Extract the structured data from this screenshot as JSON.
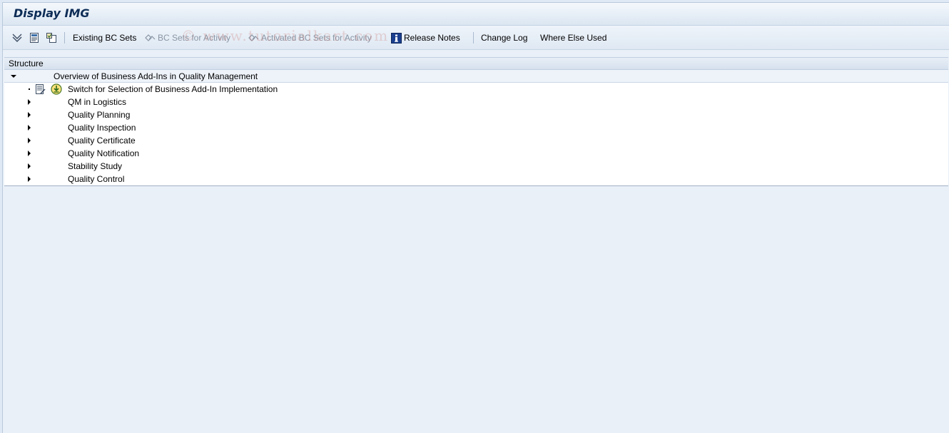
{
  "window": {
    "title": "Display IMG"
  },
  "toolbar": {
    "watermark": "© www.tutorialkart.com",
    "buttons": [
      {
        "label": "Existing BC Sets",
        "enabled": true
      },
      {
        "label": "BC Sets for Activity",
        "enabled": false
      },
      {
        "label": "Activated BC Sets for Activity",
        "enabled": false
      },
      {
        "label": "Release Notes",
        "enabled": true,
        "icon": "info-icon"
      },
      {
        "label": "Change Log",
        "enabled": true
      },
      {
        "label": "Where Else Used",
        "enabled": true
      }
    ],
    "icons": [
      "expand-all-icon",
      "documentation-icon",
      "set-favorite-icon"
    ]
  },
  "structure": {
    "header": "Structure",
    "root": {
      "label": "Overview of Business Add-Ins in Quality Management",
      "expanded": true
    },
    "children": [
      {
        "label": "Switch for Selection of Business Add-In Implementation",
        "type": "activity",
        "icons": [
          "documentation-icon",
          "execute-icon"
        ]
      },
      {
        "label": "QM in Logistics",
        "type": "folder",
        "expanded": false
      },
      {
        "label": "Quality Planning",
        "type": "folder",
        "expanded": false
      },
      {
        "label": "Quality Inspection",
        "type": "folder",
        "expanded": false
      },
      {
        "label": "Quality Certificate",
        "type": "folder",
        "expanded": false
      },
      {
        "label": "Quality Notification",
        "type": "folder",
        "expanded": false
      },
      {
        "label": "Stability Study",
        "type": "folder",
        "expanded": false
      },
      {
        "label": "Quality Control",
        "type": "folder",
        "expanded": false
      }
    ]
  },
  "colors": {
    "title_text": "#0c2c56",
    "disabled_text": "#8a96a5",
    "background": "#e9f0f8"
  }
}
